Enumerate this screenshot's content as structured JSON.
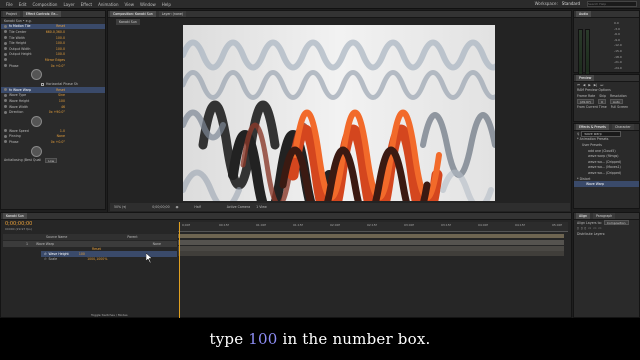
{
  "menu": {
    "items": [
      "File",
      "Edit",
      "Composition",
      "Layer",
      "Effect",
      "Animation",
      "View",
      "Window",
      "Help"
    ],
    "workspace_label": "Workspace:",
    "workspace_value": "Standard",
    "search_placeholder": "Search Help"
  },
  "effect_controls": {
    "tab_project": "Project",
    "tab_effects": "Effect Controls: Ee...",
    "breadcrumb": "Kanaki Sun • e.g.",
    "rows": [
      {
        "label": "fx  Motion Tile",
        "value": "Reset",
        "hl": true
      },
      {
        "label": "Tile Center",
        "value": "660.0,360.0"
      },
      {
        "label": "Tile Width",
        "value": "100.0"
      },
      {
        "label": "Tile Height",
        "value": "100.0"
      },
      {
        "label": "Output Width",
        "value": "100.0"
      },
      {
        "label": "Output Height",
        "value": "100.0"
      },
      {
        "label": "",
        "value": "Mirror Edges"
      },
      {
        "label": "Phase",
        "value": "0x +0.0°"
      }
    ],
    "horizontal_phase_shift": "Horizontal Phase Sh",
    "rows2": [
      {
        "label": "fx  Wave Warp",
        "value": "Reset",
        "hl": true
      },
      {
        "label": "Wave Type",
        "value": "Sine"
      },
      {
        "label": "Wave Height",
        "value": "100"
      },
      {
        "label": "Wave Width",
        "value": "46"
      },
      {
        "label": "Direction",
        "value": "0x +90.0°"
      }
    ],
    "rows3": [
      {
        "label": "Wave Speed",
        "value": "1.0"
      },
      {
        "label": "Pinning",
        "value": "None"
      },
      {
        "label": "Phase",
        "value": "0x +0.0°"
      }
    ],
    "antialiasing_label": "Antialiasing (Best Quali",
    "antialiasing_value": "Low"
  },
  "composition": {
    "tab_comp": "Composition: Kanaki Sun",
    "tab_layer": "Layer: (none)",
    "crumb": "Kanaki Sun"
  },
  "viewer_toolbar": {
    "zoom": "50% (▾)",
    "timecode": "0;00;00;00",
    "resolution": "Half",
    "camera": "Active Camera",
    "views": "1 View"
  },
  "timeline": {
    "tab": "Kanaki Sun",
    "timecode": "0;00;00;00",
    "fps": "00000 (29.97 fps)",
    "col_source": "Source Name",
    "col_parent": "Parent",
    "layer_num": "1",
    "layer_name": "Wave Warp",
    "prop_reset": "Reset",
    "prop_name": "Wave Height",
    "prop_value": "100",
    "scale_label": "Scale",
    "scale_value": "1000,1000%",
    "parent_none": "None",
    "ticks": [
      "0;00f",
      "00:15f",
      "01:00f",
      "01:15f",
      "02:00f",
      "02:15f",
      "03:00f",
      "03:15f",
      "04:00f",
      "04:15f",
      "05:00f"
    ],
    "footer": "Toggle Switches / Modes"
  },
  "right_panels": {
    "audio_tab": "Audio",
    "audio_levels": [
      "0.0",
      "-3.0",
      "-6.0",
      "-9.0",
      "-12.0",
      "-15.0",
      "-18.0",
      "-21.0",
      "-24.0"
    ],
    "preview_tab": "Preview",
    "ram_preview": "RAM Preview Options",
    "frame_rate": "Frame Rate",
    "skip": "Skip",
    "resolution": "Resolution",
    "frame_rate_value": "(29.97)",
    "skip_value": "0",
    "resolution_value": "Auto",
    "from_current": "From Current Time",
    "full_screen": "Full Screen",
    "effects_tab": "Effects & Presets",
    "character_tab": "Character",
    "search_value": "wave warp",
    "animation_presets": "* Animation Presets",
    "user_presets": "User Presets",
    "preset_items": [
      "add one (Cloud5)",
      "wave warp (filmgs)",
      "wave wa... (Dripped)",
      "wave wa... (Moves1)",
      "wave wa... (Dripped)"
    ],
    "distort": "* Distort",
    "wave_warp": "Wave Warp",
    "align_tab": "Align",
    "paragraph_tab": "Paragraph",
    "align_layers_to": "Align Layers to:",
    "align_composition": "Composition",
    "distribute_layers": "Distribute Layers:"
  },
  "caption": {
    "prefix": "type",
    "number": "100",
    "suffix": "in the number box."
  },
  "colors": {
    "accent_value": "#e9a13b",
    "caption_number": "#8e8ef5",
    "playhead": "#e0a020"
  }
}
